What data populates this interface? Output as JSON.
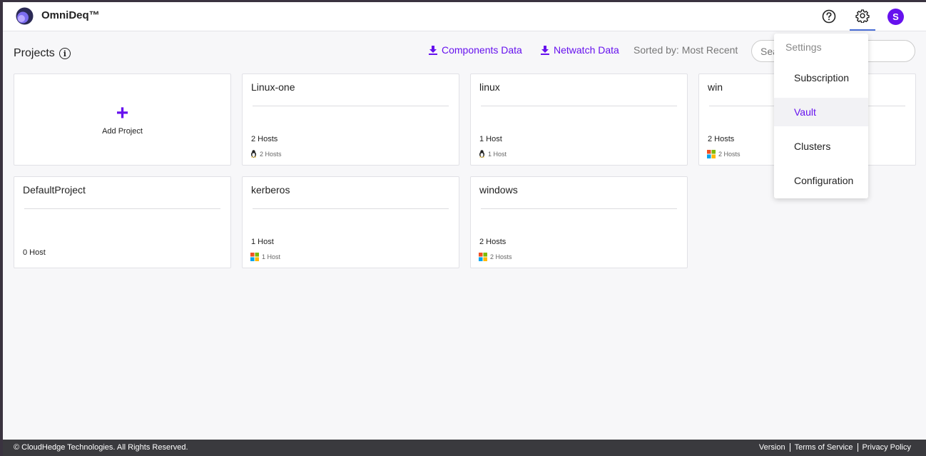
{
  "header": {
    "brand": "OmniDeq™",
    "avatar_initial": "S"
  },
  "toolbar": {
    "title": "Projects",
    "info_glyph": "i",
    "components_link": "Components Data",
    "netwatch_link": "Netwatch Data",
    "sorted_by": "Sorted by: Most Recent",
    "search_placeholder": "Search"
  },
  "add_project": {
    "glyph": "+",
    "label": "Add Project"
  },
  "projects": [
    {
      "name": "Linux-one",
      "hosts": "2 Hosts",
      "os": "linux",
      "os_hosts": "2 Hosts"
    },
    {
      "name": "linux",
      "hosts": "1 Host",
      "os": "linux",
      "os_hosts": "1 Host"
    },
    {
      "name": "win",
      "hosts": "2 Hosts",
      "os": "windows",
      "os_hosts": "2 Hosts"
    },
    {
      "name": "DefaultProject",
      "hosts": "0 Host",
      "os": "",
      "os_hosts": ""
    },
    {
      "name": "kerberos",
      "hosts": "1 Host",
      "os": "windows",
      "os_hosts": "1 Host"
    },
    {
      "name": "windows",
      "hosts": "2 Hosts",
      "os": "windows",
      "os_hosts": "2 Hosts"
    }
  ],
  "settings_menu": {
    "header": "Settings",
    "items": [
      "Subscription",
      "Vault",
      "Clusters",
      "Configuration"
    ],
    "active_item": "Vault"
  },
  "footer": {
    "copyright": "© CloudHedge Technologies. All Rights Reserved.",
    "links": [
      "Version",
      "Terms of Service",
      "Privacy Policy"
    ]
  },
  "colors": {
    "accent": "#6611ee",
    "footer_bg": "#3a3a3e",
    "tab_underline": "#4b6fd6"
  }
}
